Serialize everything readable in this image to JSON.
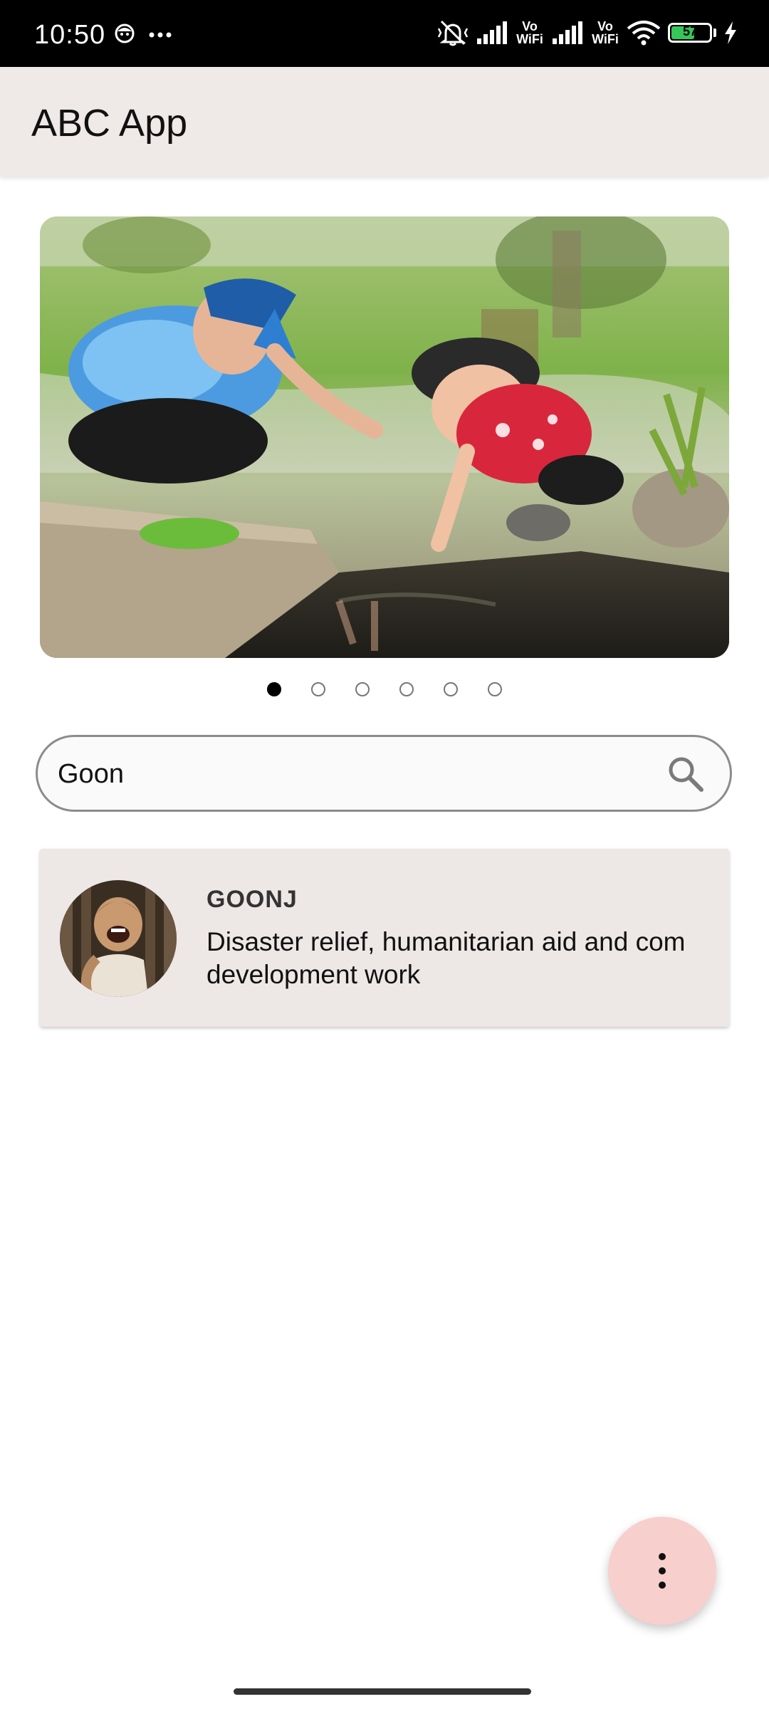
{
  "status_bar": {
    "time": "10:50",
    "wifi_label_1": "Vo WiFi",
    "wifi_label_2": "Vo WiFi",
    "battery_level": "57",
    "icons": [
      "face-icon",
      "more-dots-icon",
      "mute-icon",
      "signal-icon",
      "wifi-icon",
      "battery-icon",
      "charging-icon"
    ]
  },
  "app_bar": {
    "title": "ABC App"
  },
  "carousel": {
    "image": "children-playing-by-water-image",
    "page_count": 6,
    "active_index": 0
  },
  "search": {
    "value": "Goon",
    "placeholder": "",
    "icon": "search-icon"
  },
  "results": [
    {
      "title": "GOONJ",
      "description": "Disaster relief, humanitarian aid and com\ndevelopment work",
      "avatar": "laughing-child-avatar"
    }
  ],
  "fab": {
    "icon": "more-vertical-icon"
  },
  "colors": {
    "app_bar_bg": "#efe9e8",
    "card_bg": "#ede7e6",
    "fab_bg": "#f7cfcc",
    "battery_green": "#35c759"
  }
}
